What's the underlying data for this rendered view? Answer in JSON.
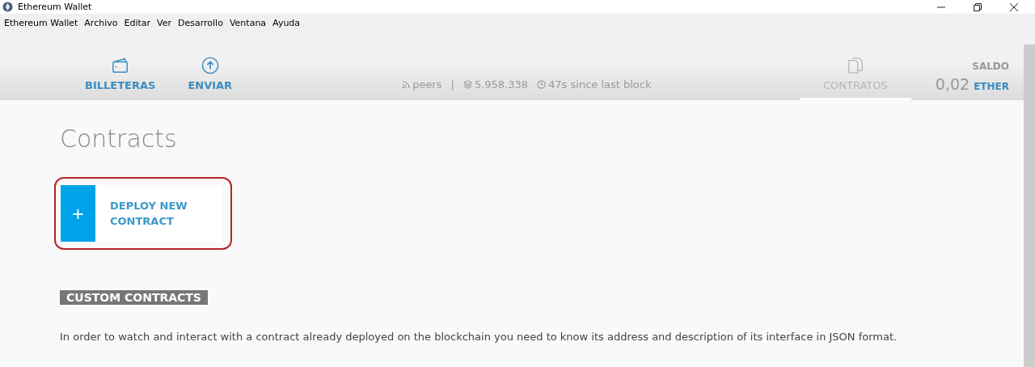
{
  "window": {
    "title": "Ethereum Wallet"
  },
  "menu": [
    "Ethereum Wallet",
    "Archivo",
    "Editar",
    "Ver",
    "Desarrollo",
    "Ventana",
    "Ayuda"
  ],
  "tabs": [
    {
      "label": "BILLETERAS",
      "kind": "wallet",
      "selected": false
    },
    {
      "label": "ENVIAR",
      "kind": "send",
      "selected": false
    },
    {
      "label": "CONTRATOS",
      "kind": "contracts",
      "selected": true
    }
  ],
  "status": {
    "peers": "peers",
    "separator": "|",
    "block": "5.958.338",
    "since": "47s since last block"
  },
  "balance": {
    "label": "SALDO",
    "amount": "0,02",
    "unit": "ETHER"
  },
  "page": {
    "title": "Contracts",
    "deploy": {
      "icon": "+",
      "label": "DEPLOY NEW CONTRACT",
      "highlighted": true
    },
    "section": "CUSTOM CONTRACTS",
    "text": "In order to watch and interact with a contract already deployed on the blockchain you need to know its address and description of its interface in JSON format."
  }
}
